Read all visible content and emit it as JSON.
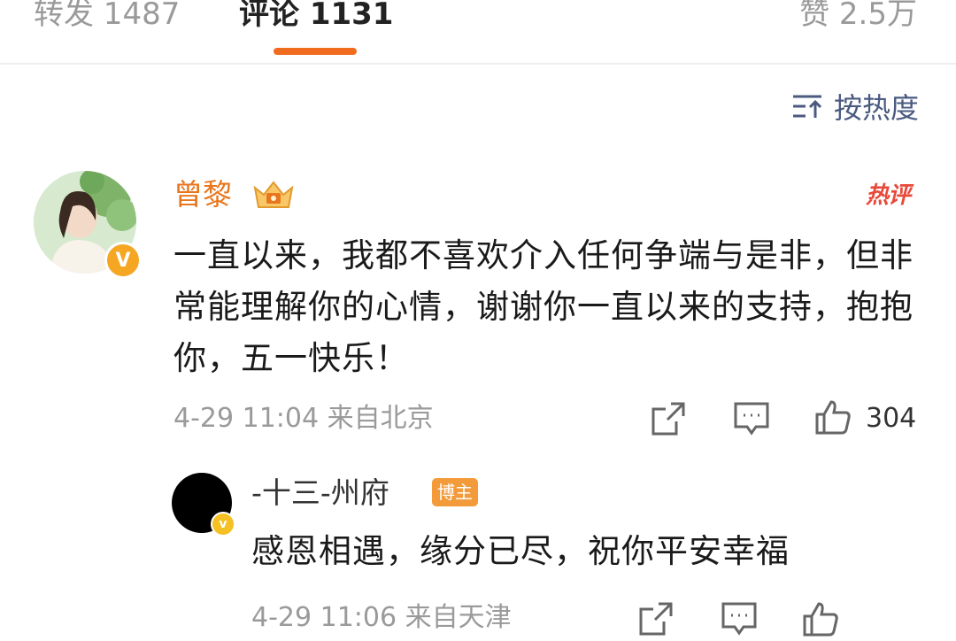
{
  "tabs": {
    "repost_label": "转发 1487",
    "comment_label": "评论 1131",
    "like_label": "赞 2.5万"
  },
  "sort": {
    "label": "按热度"
  },
  "comment": {
    "author": "曾黎",
    "hot_tag": "热评",
    "text": "一直以来，我都不喜欢介入任何争端与是非，但非常能理解你的心情，谢谢你一直以来的支持，抱抱你，五一快乐！",
    "time": "4-29 11:04",
    "location": "来自北京",
    "like_count": "304"
  },
  "reply": {
    "author": "-十三-州府",
    "badge": "博主",
    "text": "感恩相遇，缘分已尽，祝你平安幸福",
    "time": "4-29 11:06",
    "location": "来自天津"
  },
  "colors": {
    "accent": "#f26c1f",
    "author_orange": "#e8761c",
    "hot_red": "#e84a3a",
    "meta_gray": "#9a9a9a"
  },
  "icons": [
    "sort-icon",
    "crown-icon",
    "vip-badge-icon",
    "share-icon",
    "comment-icon",
    "like-icon"
  ]
}
